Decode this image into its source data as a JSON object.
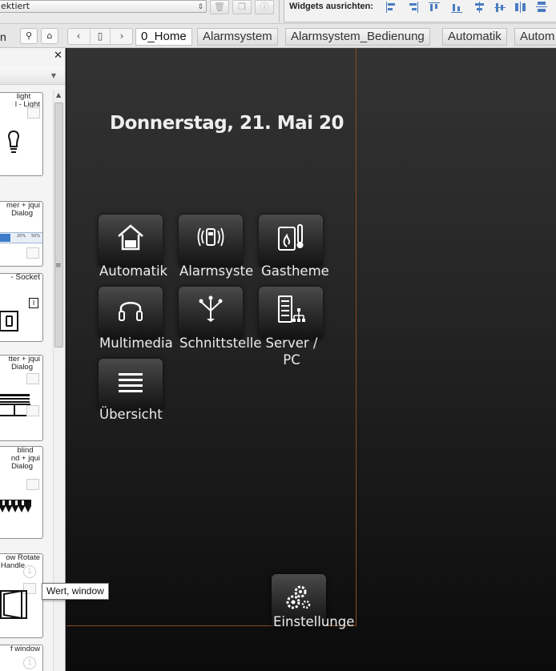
{
  "toolbar": {
    "select_value": "ektiert",
    "align_label": "Widgets ausrichten:"
  },
  "tabs": {
    "stub_label": "n",
    "views": [
      "0_Home",
      "Alarmsystem",
      "Alarmsystem_Bedienung",
      "Automatik",
      "Autom"
    ]
  },
  "palette": {
    "widgets": [
      {
        "line1": "light",
        "line2": "l - Light"
      },
      {
        "line1": "mer + jqui",
        "line2": "Dialog"
      },
      {
        "line1": "- Socket",
        "line2": ""
      },
      {
        "line1": "tter + jqui",
        "line2": "Dialog"
      },
      {
        "line1": "blind",
        "line2": "nd + jqui",
        "line3": "Dialog"
      },
      {
        "line1": "ow Rotate",
        "line2": "Handle"
      },
      {
        "line1": "f window",
        "line2": ""
      }
    ],
    "preview_bar_values": [
      "20%",
      "50%"
    ]
  },
  "tooltip": "Wert, window",
  "canvas": {
    "date": "Donnerstag, 21. Mai 20",
    "tiles": [
      {
        "label": "Automatik",
        "icon": "house-auto-icon"
      },
      {
        "label": "Alarmsyste",
        "icon": "alarm-sensor-icon"
      },
      {
        "label": "Gastheme",
        "icon": "gas-heater-icon"
      },
      {
        "label": "Multimedia",
        "icon": "headphones-icon"
      },
      {
        "label": "Schnittstelle",
        "icon": "network-interface-icon"
      },
      {
        "label_line1": "Server /",
        "label_line2": "PC",
        "icon": "server-icon"
      },
      {
        "label": "Übersicht",
        "icon": "list-icon"
      },
      {
        "label": "Einstellunge",
        "icon": "gears-icon"
      }
    ]
  },
  "colors": {
    "frame_border": "#8a4a1c",
    "align_icon": "#4a7cc0",
    "canvas_top": "#333333",
    "canvas_bottom": "#0b0b0b"
  }
}
